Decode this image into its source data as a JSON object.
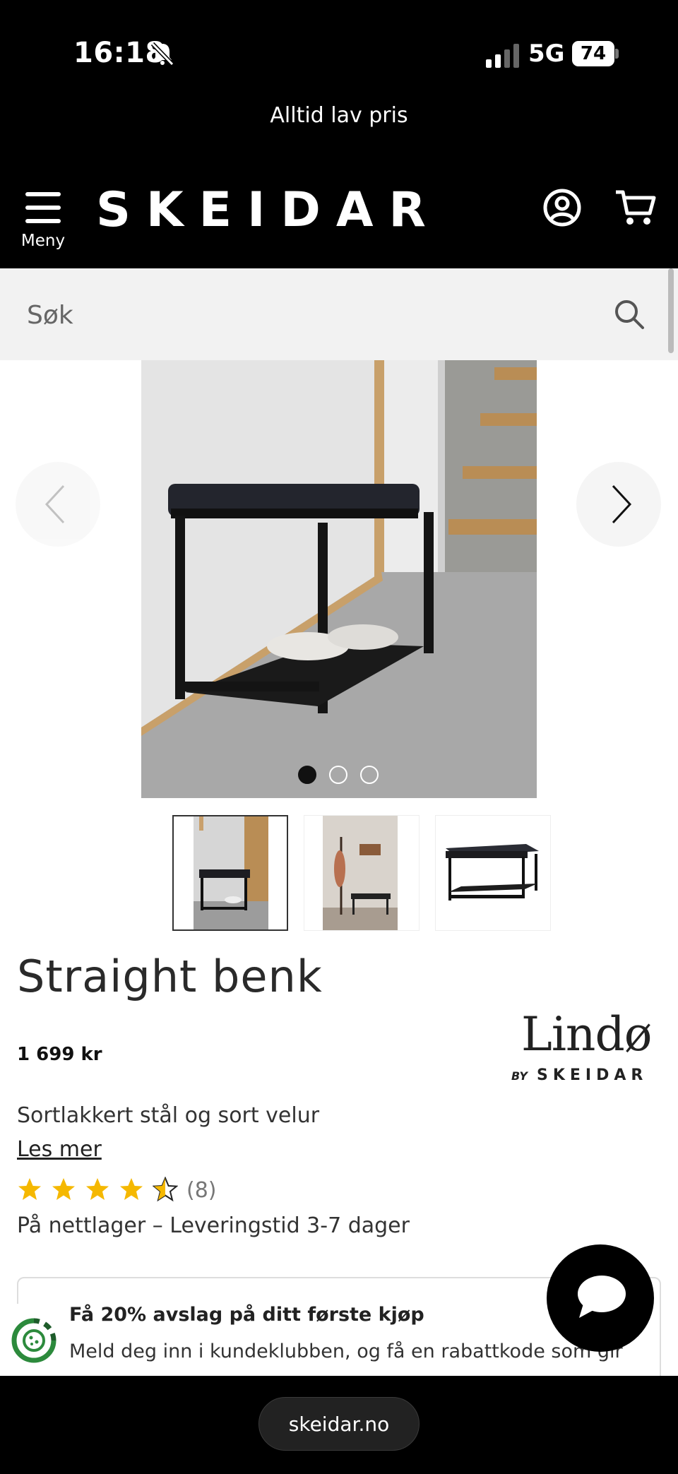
{
  "status_bar": {
    "time": "16:18",
    "network": "5G",
    "battery": "74"
  },
  "promo": {
    "text": "Alltid lav pris"
  },
  "header": {
    "menu_label": "Meny",
    "logo": "SKEIDAR"
  },
  "search": {
    "placeholder": "Søk"
  },
  "carousel": {
    "slide_count": 3,
    "active_slide": 1
  },
  "thumbnails": [
    {
      "name": "bench-hallway-photo",
      "active": true
    },
    {
      "name": "bench-with-coat-rack-photo",
      "active": false
    },
    {
      "name": "bench-product-photo",
      "active": false
    }
  ],
  "product": {
    "title": "Straight benk",
    "price": "1 699 kr",
    "description": "Sortlakkert stål og sort velur",
    "read_more": "Les mer",
    "rating": {
      "stars": 4.5,
      "count_label": "(8)"
    },
    "delivery": "På nettlager – Leveringstid 3-7 dager"
  },
  "brand": {
    "name": "Lindø",
    "by": "BY",
    "sub": "SKEIDAR"
  },
  "club": {
    "title": "Få 20% avslag på ditt første kjøp",
    "text": "Meld deg inn i kundeklubben, og få en rabattkode som gir"
  },
  "browser": {
    "url": "skeidar.no"
  },
  "colors": {
    "background": "#ffffff",
    "header": "#000000",
    "star": "#f5b800",
    "search_bg": "#f2f2f2"
  }
}
